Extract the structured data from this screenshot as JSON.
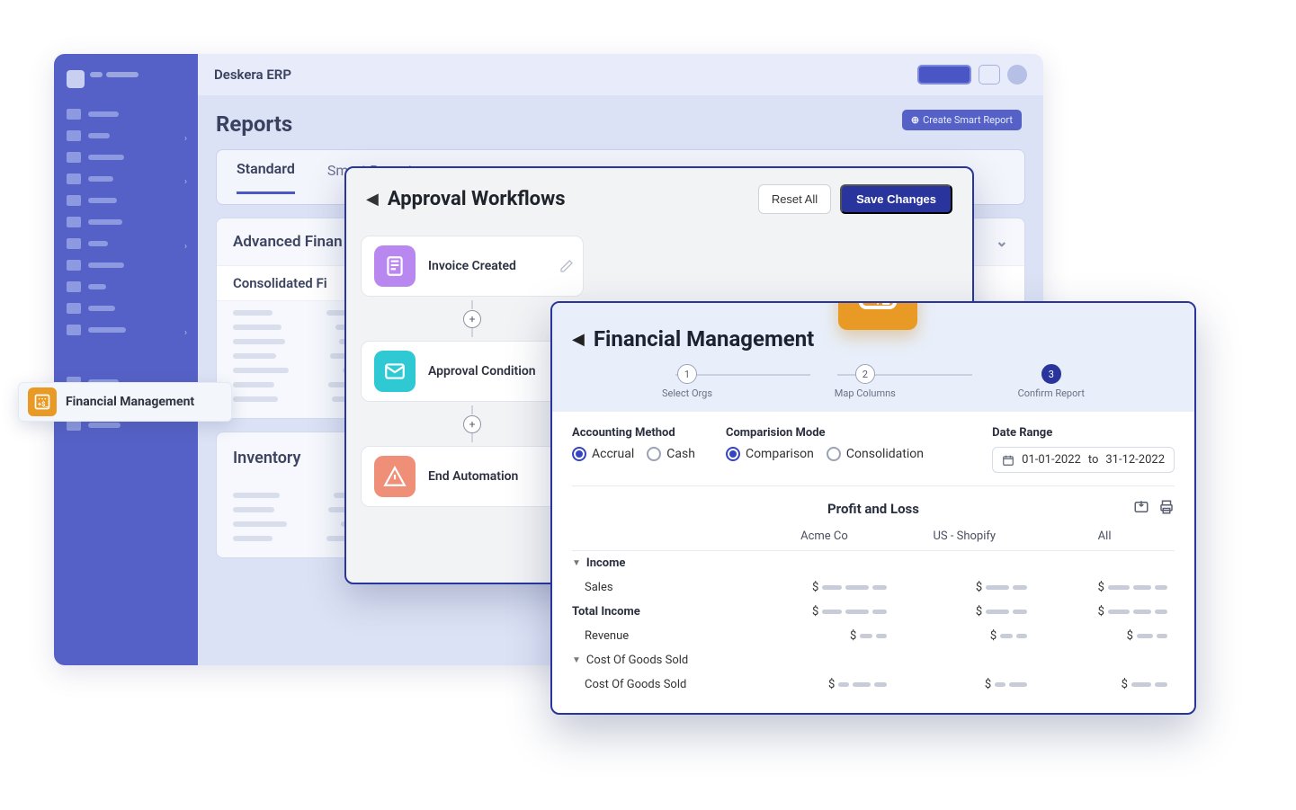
{
  "app": {
    "title": "Deskera ERP",
    "create_button": "Create Smart Report"
  },
  "reports": {
    "title": "Reports",
    "tabs": {
      "standard": "Standard",
      "smart": "Smart Reports"
    },
    "advanced_section": "Advanced Finan",
    "consolidated_row": "Consolidated Fi",
    "inventory_section": "Inventory"
  },
  "callout": {
    "label": "Financial Management"
  },
  "workflow": {
    "title": "Approval Workflows",
    "reset": "Reset All",
    "save": "Save Changes",
    "steps": {
      "invoice": "Invoice Created",
      "condition": "Approval Condition",
      "end": "End Automation"
    }
  },
  "fm": {
    "title": "Financial Management",
    "steps": [
      {
        "num": "1",
        "label": "Select Orgs"
      },
      {
        "num": "2",
        "label": "Map Columns"
      },
      {
        "num": "3",
        "label": "Confirm Report"
      }
    ],
    "accounting": {
      "title": "Accounting Method",
      "accrual": "Accrual",
      "cash": "Cash"
    },
    "comparison": {
      "title": "Comparision Mode",
      "comparison": "Comparison",
      "consolidation": "Consolidation"
    },
    "date": {
      "title": "Date Range",
      "from": "01-01-2022",
      "to_label": "to",
      "to": "31-12-2022"
    },
    "report": {
      "title": "Profit and Loss",
      "columns": [
        "Acme Co",
        "US - Shopify",
        "All"
      ],
      "rows": {
        "income": "Income",
        "sales": "Sales",
        "total_income": "Total Income",
        "revenue": "Revenue",
        "cogs_head": "Cost Of Goods Sold",
        "cogs": "Cost Of Goods Sold"
      },
      "dollar": "$"
    }
  }
}
